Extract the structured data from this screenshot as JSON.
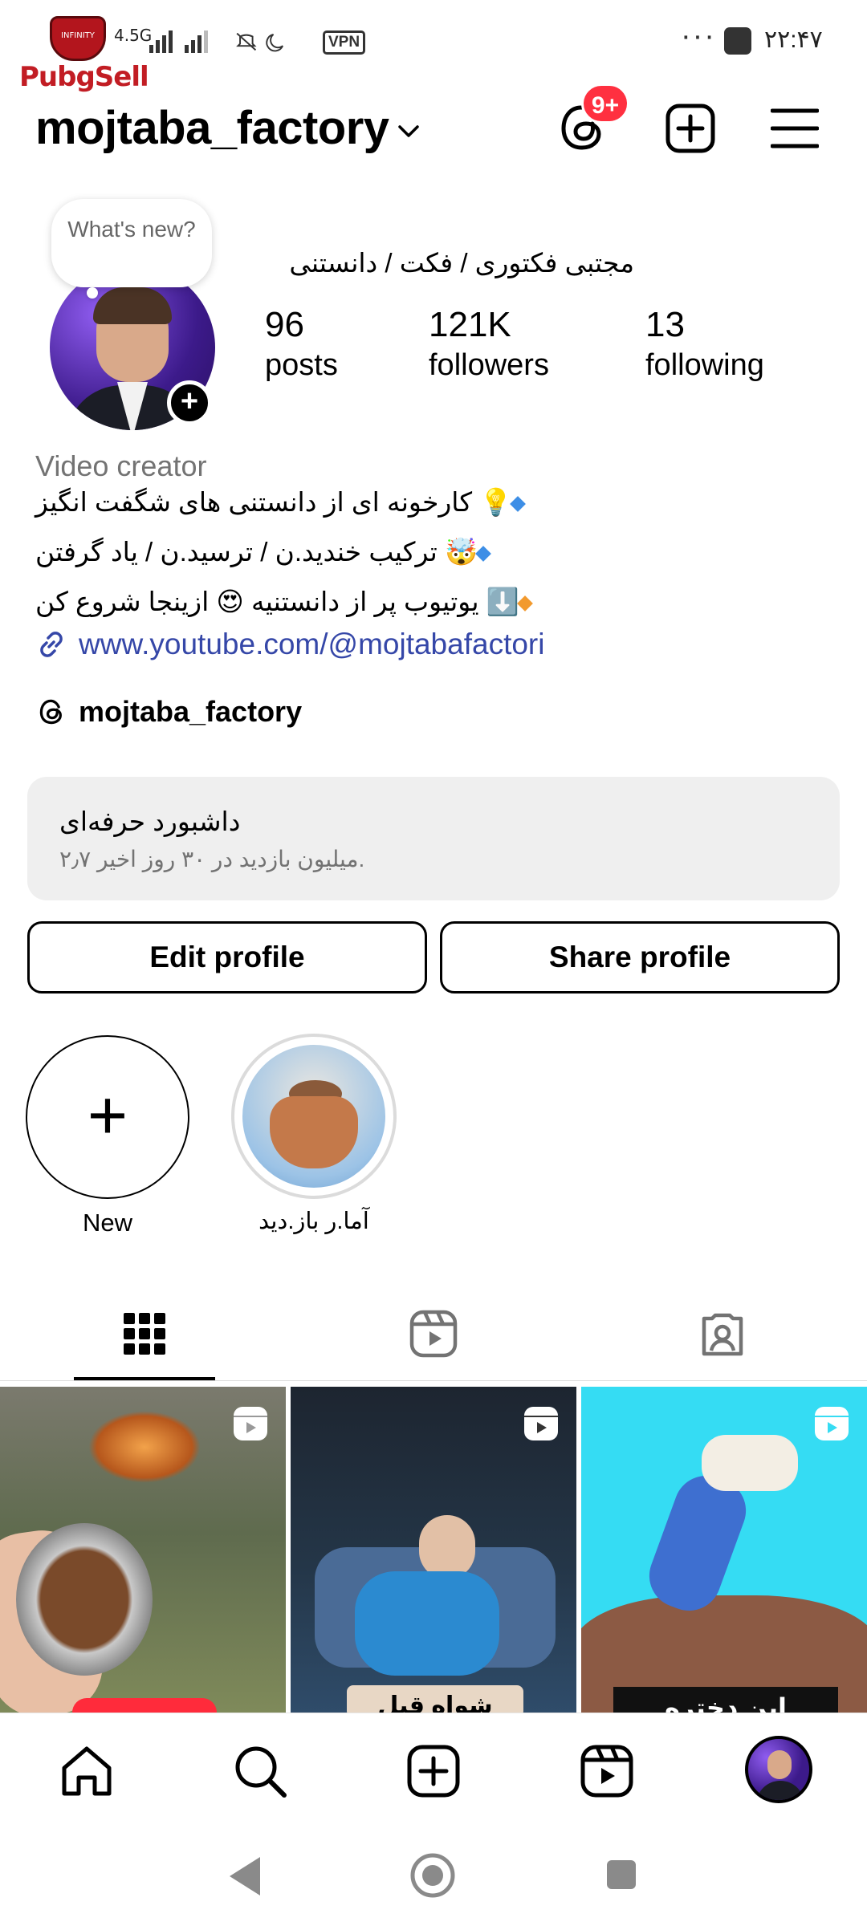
{
  "status_bar": {
    "brand_text": "PubgSell",
    "logo_caption": "INFINITY",
    "network": "4.5G",
    "vpn": "VPN",
    "more": "···",
    "time": "۲۲:۴۷"
  },
  "header": {
    "username": "mojtaba_factory",
    "notification_badge": "9+"
  },
  "profile": {
    "note": "What's new?",
    "full_name": "مجتبی فکتوری / فکت / دانستنی",
    "stats": [
      {
        "value": "96",
        "label": "posts"
      },
      {
        "value": "121K",
        "label": "followers"
      },
      {
        "value": "13",
        "label": "following"
      }
    ],
    "category": "Video creator",
    "bio": [
      {
        "text": "💡 کارخونه ای از دانستنی های شگفت انگیز",
        "bullet_color": "#3d8ee6"
      },
      {
        "text": "🤯 ترکیب خندید.ن / ترسید.ن / یاد گرفتن",
        "bullet_color": "#3d8ee6"
      },
      {
        "text": "⬇️ یوتیوب پر از دانستنیه 😍 ازینجا شروع کن",
        "bullet_color": "#f29a2e"
      }
    ],
    "link": "www.youtube.com/@mojtabafactori",
    "threads_handle": "mojtaba_factory"
  },
  "dashboard": {
    "title": "داشبورد حرفه‌ای",
    "subtitle": "۲٫۷ میلیون بازدید در ۳۰ روز اخیر."
  },
  "buttons": {
    "edit": "Edit profile",
    "share": "Share profile"
  },
  "highlights": [
    {
      "label": "New"
    },
    {
      "label": "آما.ر باز.دید"
    }
  ],
  "tabs": [
    "grid-icon",
    "reels-icon",
    "tagged-icon"
  ],
  "grid_posts": [
    {
      "type": "reel",
      "caption_color": "#ff2b3b"
    },
    {
      "type": "reel",
      "caption": "شواه قبل خواب"
    },
    {
      "type": "reel",
      "caption": "این دختره"
    }
  ],
  "bottom_nav": [
    "home-icon",
    "search-icon",
    "create-icon",
    "reels-icon",
    "profile-avatar"
  ],
  "colors": {
    "link": "#3547a8",
    "secondary_text": "#737373",
    "badge": "#ff3040",
    "dashboard_bg": "#efefef"
  }
}
